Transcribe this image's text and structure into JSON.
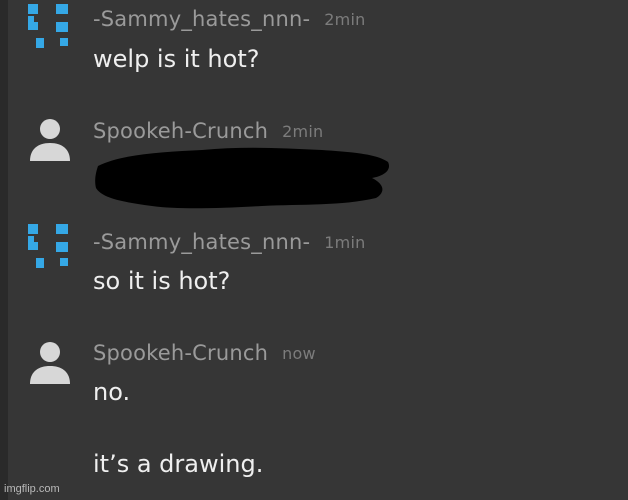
{
  "messages": [
    {
      "author": "-Sammy_hates_nnn-",
      "time": "2min",
      "avatar_icon": "pixel-avatar-icon",
      "text": "welp is it hot?"
    },
    {
      "author": "Spookeh-Crunch",
      "time": "2min",
      "avatar_icon": "default-user-icon",
      "text": ""
    },
    {
      "author": "-Sammy_hates_nnn-",
      "time": "1min",
      "avatar_icon": "pixel-avatar-icon",
      "text": "so it is hot?"
    },
    {
      "author": "Spookeh-Crunch",
      "time": "now",
      "avatar_icon": "default-user-icon",
      "lines": [
        "no.",
        "it’s a drawing."
      ]
    }
  ],
  "watermark": "imgflip.com",
  "colors": {
    "background": "#363636",
    "author": "#9a9a9a",
    "time": "#7c7c7c",
    "text": "#efefef",
    "pixel_avatar": "#35a8e6",
    "default_avatar": "#d7d7d7",
    "redaction": "#000000"
  }
}
